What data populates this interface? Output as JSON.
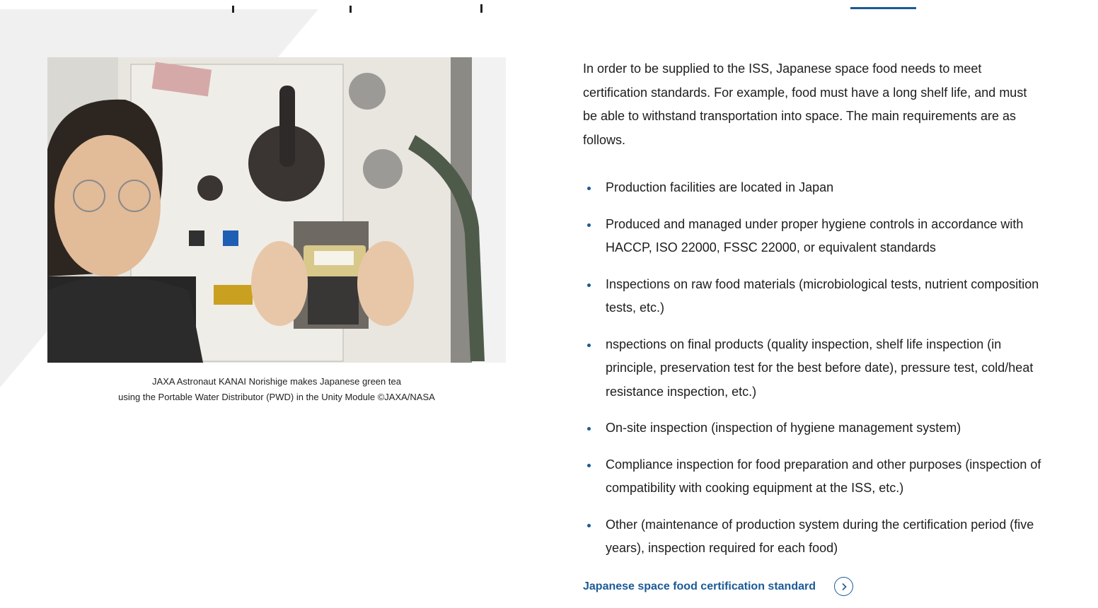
{
  "figure": {
    "caption_line1": "JAXA Astronaut KANAI Norishige makes Japanese green tea",
    "caption_line2": "using the Portable Water Distributor (PWD) in the Unity Module ©JAXA/NASA",
    "photo_icon": "astronaut-photo"
  },
  "main": {
    "intro": "In order to be supplied to the ISS, Japanese space food needs to meet certification standards. For example, food must have a long shelf life, and must be able to withstand transportation into space. The main requirements are as follows.",
    "requirements": [
      "Production facilities are located in Japan",
      "Produced and managed under proper hygiene controls in accordance with HACCP, ISO 22000, FSSC 22000, or equivalent standards",
      "Inspections on raw food materials (microbiological tests, nutrient composition tests, etc.)",
      "nspections on final products (quality inspection, shelf life inspection (in principle, preservation test for the best before date), pressure test, cold/heat resistance inspection, etc.)",
      "On-site inspection (inspection of hygiene management system)",
      "Compliance inspection for food preparation and other purposes (inspection of compatibility with cooking equipment at the ISS, etc.)",
      "Other (maintenance of production system during the certification period (five years), inspection required for each food)"
    ]
  },
  "link": {
    "label": "Japanese space food certification standard",
    "icon": "chevron-right-circle-icon"
  },
  "colors": {
    "accent": "#1b5a96",
    "text": "#1d1d1d",
    "background_shape": "#f0f0f0"
  }
}
